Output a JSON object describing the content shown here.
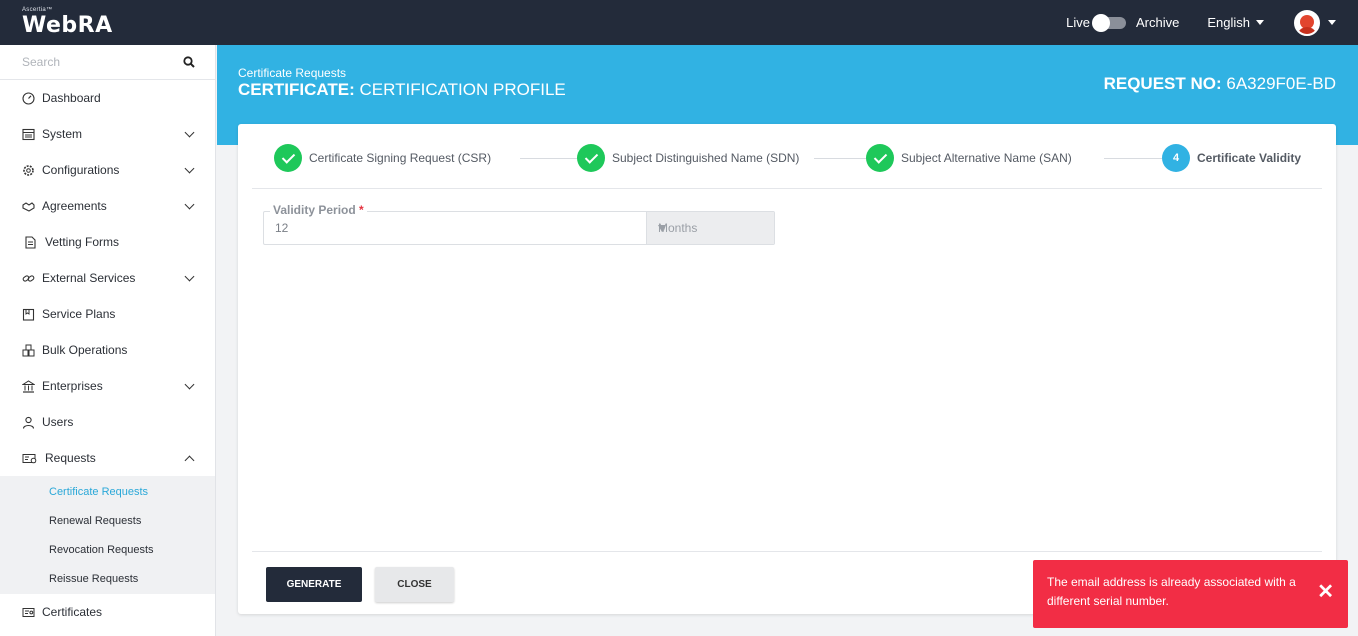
{
  "topbar": {
    "logo_small": "Ascertia™",
    "logo": "WebRA",
    "live_label": "Live",
    "archive_label": "Archive",
    "language": "English"
  },
  "sidebar": {
    "search_placeholder": "Search",
    "items": [
      {
        "label": "Dashboard",
        "icon": "dashboard-icon"
      },
      {
        "label": "System",
        "icon": "system-icon"
      },
      {
        "label": "Configurations",
        "icon": "gear-icon"
      },
      {
        "label": "Agreements",
        "icon": "handshake-icon"
      },
      {
        "label": "Vetting Forms",
        "icon": "form-icon"
      },
      {
        "label": "External Services",
        "icon": "link-icon"
      },
      {
        "label": "Service Plans",
        "icon": "plans-icon"
      },
      {
        "label": "Bulk Operations",
        "icon": "bulk-icon"
      },
      {
        "label": "Enterprises",
        "icon": "bank-icon"
      },
      {
        "label": "Users",
        "icon": "user-icon"
      },
      {
        "label": "Requests",
        "icon": "requests-icon"
      },
      {
        "label": "Certificates",
        "icon": "certificate-icon"
      }
    ],
    "requests_sub": [
      {
        "label": "Certificate Requests"
      },
      {
        "label": "Renewal Requests"
      },
      {
        "label": "Revocation Requests"
      },
      {
        "label": "Reissue Requests"
      }
    ]
  },
  "banner": {
    "breadcrumb": "Certificate Requests",
    "title_bold": "CERTIFICATE:",
    "title_rest": " CERTIFICATION PROFILE",
    "request_label": "REQUEST NO:",
    "request_no": " 6A329F0E-BD"
  },
  "stepper": {
    "steps": [
      {
        "label": "Certificate Signing Request (CSR)",
        "status": "done"
      },
      {
        "label": "Subject Distinguished Name (SDN)",
        "status": "done"
      },
      {
        "label": "Subject Alternative Name (SAN)",
        "status": "done"
      },
      {
        "label": "Certificate Validity",
        "status": "current",
        "number": "4"
      }
    ]
  },
  "form": {
    "validity_label": "Validity Period",
    "required_mark": "*",
    "validity_value": "12",
    "unit": "Months"
  },
  "actions": {
    "generate": "GENERATE",
    "close": "CLOSE"
  },
  "toast": {
    "message": "The email address is already associated with a different serial number.",
    "close": "✕"
  },
  "colors": {
    "topbar": "#232b3a",
    "accent": "#31b2e3",
    "success": "#1ec85a",
    "error": "#f22d45"
  }
}
